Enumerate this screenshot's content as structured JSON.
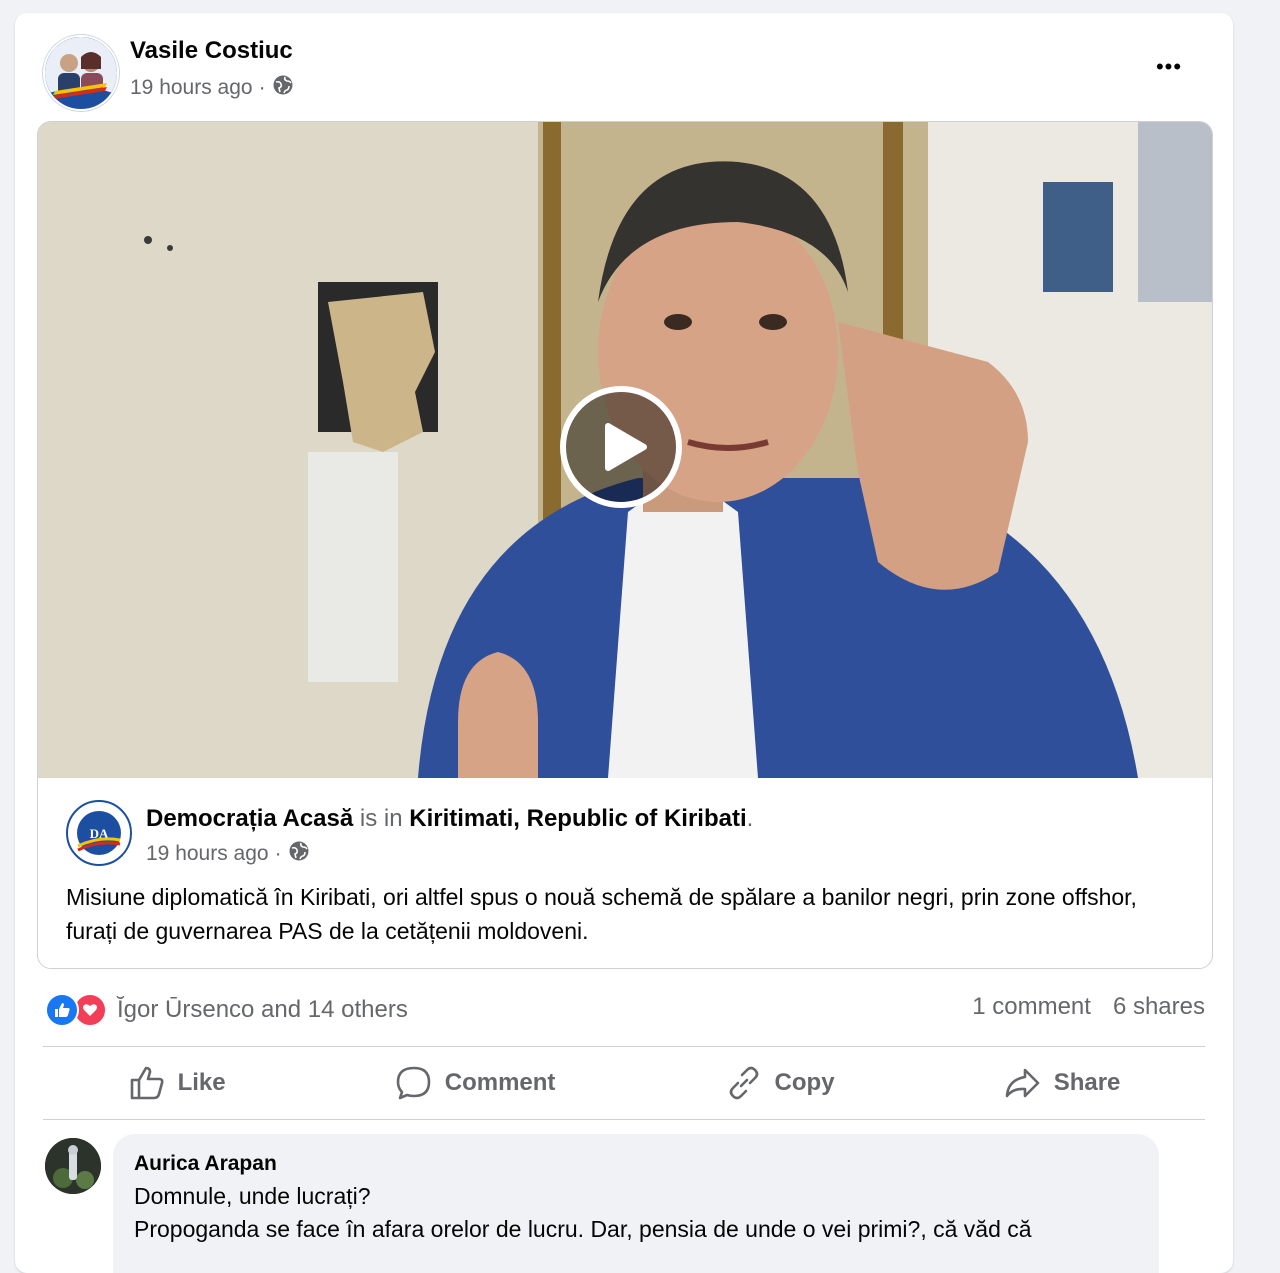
{
  "post": {
    "author": "Vasile Costiuc",
    "time": "19 hours ago",
    "separator": "·",
    "more_label": "•••"
  },
  "shared": {
    "page_name": "Democrația Acasă",
    "is_in": "is in",
    "location": "Kiritimati, Republic of Kiribati",
    "period": ".",
    "time": "19 hours ago",
    "separator": "·",
    "text": "Misiune diplomatică în Kiribati, ori altfel spus o nouă schemă de spălare a banilor negri, prin zone offshor, furați de guvernarea PAS de la cetățenii moldoveni."
  },
  "reactions": {
    "names": "Ĭgor Ūrsenco and 14 others",
    "comments": "1 comment",
    "shares": "6 shares"
  },
  "actions": {
    "like": "Like",
    "comment": "Comment",
    "copy": "Copy",
    "share": "Share"
  },
  "comment": {
    "name": "Aurica Arapan",
    "line1": "Domnule, unde lucrați?",
    "line2": "Propoganda se face în afara orelor de lucru. Dar, pensia de unde o vei primi?, că văd că"
  },
  "colors": {
    "accent": "#1877f2",
    "love": "#f33e58",
    "muted": "#65676b",
    "page_bg": "#f0f2f5"
  },
  "icons": {
    "privacy": "globe-icon",
    "like": "thumbs-up-icon",
    "comment": "speech-bubble-icon",
    "copy": "link-icon",
    "share": "share-arrow-icon",
    "video": "play-icon"
  }
}
